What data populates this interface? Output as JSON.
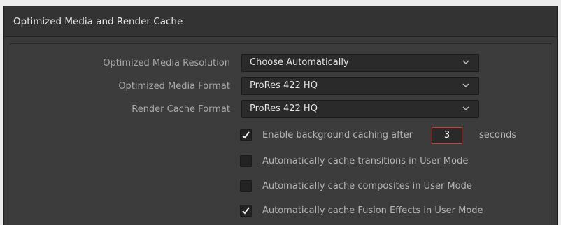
{
  "panel": {
    "title": "Optimized Media and Render Cache"
  },
  "settings": {
    "optimized_media_resolution": {
      "label": "Optimized Media Resolution",
      "value": "Choose Automatically"
    },
    "optimized_media_format": {
      "label": "Optimized Media Format",
      "value": "ProRes 422 HQ"
    },
    "render_cache_format": {
      "label": "Render Cache Format",
      "value": "ProRes 422 HQ"
    }
  },
  "checkboxes": {
    "background_caching": {
      "label": "Enable background caching after",
      "checked": true,
      "seconds": "3",
      "suffix": "seconds"
    },
    "cache_transitions": {
      "label": "Automatically cache transitions in User Mode",
      "checked": false
    },
    "cache_composites": {
      "label": "Automatically cache composites in User Mode",
      "checked": false
    },
    "cache_fusion": {
      "label": "Automatically cache Fusion Effects in User Mode",
      "checked": true
    }
  },
  "colors": {
    "panel_bg": "#3a3a3a",
    "field_bg": "#2a2a2a",
    "accent_red": "#d83a33",
    "text": "#a8a8a8"
  },
  "icons": {
    "dropdown": "chevron-down-icon",
    "check": "checkmark-icon"
  }
}
